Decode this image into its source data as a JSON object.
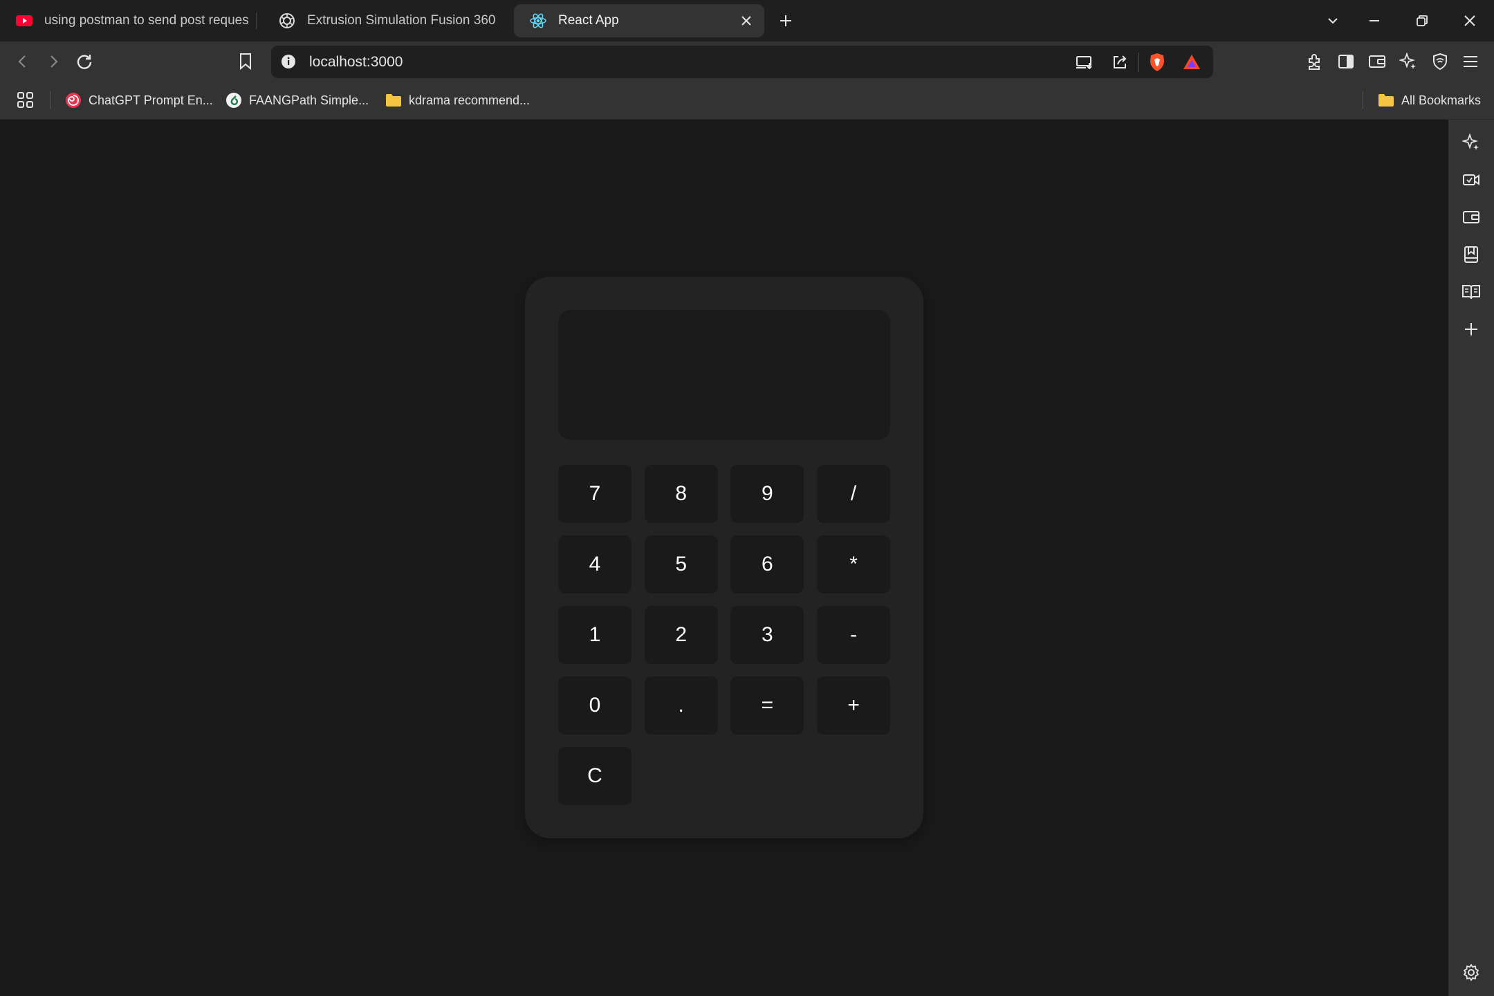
{
  "browser": {
    "tabs": [
      {
        "title": "using postman to send post request",
        "icon": "youtube-icon"
      },
      {
        "title": "Extrusion Simulation Fusion 360",
        "icon": "openai-icon"
      },
      {
        "title": "React App",
        "icon": "react-icon",
        "active": true
      }
    ],
    "address": {
      "url": "localhost:3000"
    },
    "bookmarks": [
      {
        "label": "ChatGPT Prompt En...",
        "icon": "spiral-icon"
      },
      {
        "label": "FAANGPath Simple...",
        "icon": "faangpath-icon"
      },
      {
        "label": "kdrama recommend...",
        "icon": "folder-icon"
      }
    ],
    "all_bookmarks_label": "All Bookmarks"
  },
  "calculator": {
    "display": "",
    "keys": [
      "7",
      "8",
      "9",
      "/",
      "4",
      "5",
      "6",
      "*",
      "1",
      "2",
      "3",
      "-",
      "0",
      ".",
      "=",
      "+",
      "C"
    ]
  },
  "colors": {
    "page_bg": "#1a1a1a",
    "calc_bg": "#232323",
    "key_bg": "#1a1a1a",
    "chrome_bg": "#333333"
  }
}
